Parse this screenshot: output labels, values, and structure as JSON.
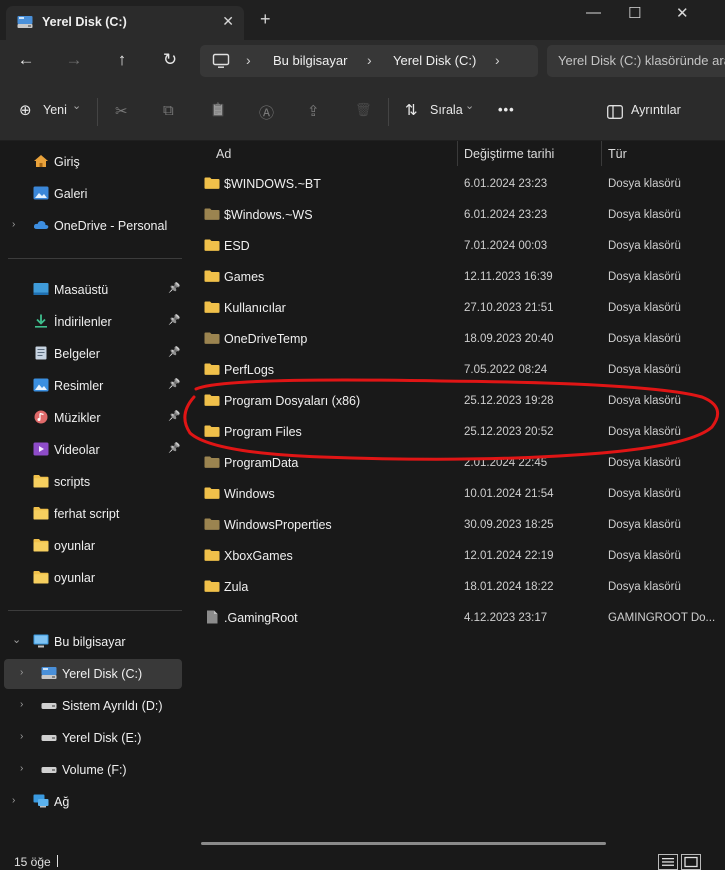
{
  "window": {
    "tab_title": "Yerel Disk (C:)",
    "tab_close": "✕",
    "new_tab": "+",
    "minimize": "—",
    "maximize": "☐",
    "close": "✕"
  },
  "navigation": {
    "back": "←",
    "forward": "→",
    "up": "↑",
    "refresh": "↻",
    "separator": "›",
    "breadcrumbs": [
      "Bu bilgisayar",
      "Yerel Disk (C:)"
    ],
    "search_placeholder": "Yerel Disk (C:) klasöründe ara"
  },
  "commandbar": {
    "new_plus": "⊕",
    "new_label": "Yeni",
    "new_chevron": "⌄",
    "cut": "✂",
    "copy": "⧉",
    "paste": "📋",
    "rename": "Ⓐ",
    "share": "⇪",
    "delete": "🗑",
    "sort_icon": "⇅",
    "sort_label": "Sırala",
    "sort_chevron": "⌄",
    "more": "•••",
    "details_label": "Ayrıntılar"
  },
  "sidebar": {
    "chevron_collapsed": "›",
    "chevron_expanded": "⌄",
    "pin": "📌",
    "top": [
      {
        "label": "Giriş",
        "icon": "home-icon"
      },
      {
        "label": "Galeri",
        "icon": "gallery-icon"
      },
      {
        "label": "OneDrive - Personal",
        "icon": "cloud-icon"
      }
    ],
    "quick_access": [
      {
        "label": "Masaüstü",
        "icon": "desktop-icon",
        "pinned": true
      },
      {
        "label": "İndirilenler",
        "icon": "download-icon",
        "pinned": true
      },
      {
        "label": "Belgeler",
        "icon": "documents-icon",
        "pinned": true
      },
      {
        "label": "Resimler",
        "icon": "pictures-icon",
        "pinned": true
      },
      {
        "label": "Müzikler",
        "icon": "music-icon",
        "pinned": true
      },
      {
        "label": "Videolar",
        "icon": "videos-icon",
        "pinned": true
      },
      {
        "label": "scripts",
        "icon": "folder-icon",
        "pinned": false
      },
      {
        "label": "ferhat script",
        "icon": "folder-icon",
        "pinned": false
      },
      {
        "label": "oyunlar",
        "icon": "folder-icon",
        "pinned": false
      },
      {
        "label": "oyunlar",
        "icon": "folder-icon",
        "pinned": false
      }
    ],
    "this_pc": {
      "label": "Bu bilgisayar",
      "icon": "computer-icon"
    },
    "drives": [
      {
        "label": "Yerel Disk (C:)",
        "icon": "system-drive-icon",
        "selected": true
      },
      {
        "label": "Sistem Ayrıldı (D:)",
        "icon": "drive-icon",
        "selected": false
      },
      {
        "label": "Yerel Disk (E:)",
        "icon": "drive-icon",
        "selected": false
      },
      {
        "label": "Volume (F:)",
        "icon": "drive-icon",
        "selected": false
      }
    ],
    "network": {
      "label": "Ağ",
      "icon": "network-icon"
    }
  },
  "filelist": {
    "columns": {
      "name": "Ad",
      "modified": "Değiştirme tarihi",
      "type": "Tür"
    },
    "sort_indicator": "⌃",
    "rows": [
      {
        "name": "$WINDOWS.~BT",
        "modified": "6.01.2024 23:23",
        "type": "Dosya klasörü",
        "kind": "folder"
      },
      {
        "name": "$Windows.~WS",
        "modified": "6.01.2024 23:23",
        "type": "Dosya klasörü",
        "kind": "folder-dim"
      },
      {
        "name": "ESD",
        "modified": "7.01.2024 00:03",
        "type": "Dosya klasörü",
        "kind": "folder"
      },
      {
        "name": "Games",
        "modified": "12.11.2023 16:39",
        "type": "Dosya klasörü",
        "kind": "folder"
      },
      {
        "name": "Kullanıcılar",
        "modified": "27.10.2023 21:51",
        "type": "Dosya klasörü",
        "kind": "folder"
      },
      {
        "name": "OneDriveTemp",
        "modified": "18.09.2023 20:40",
        "type": "Dosya klasörü",
        "kind": "folder-dim"
      },
      {
        "name": "PerfLogs",
        "modified": "7.05.2022 08:24",
        "type": "Dosya klasörü",
        "kind": "folder"
      },
      {
        "name": "Program Dosyaları (x86)",
        "modified": "25.12.2023 19:28",
        "type": "Dosya klasörü",
        "kind": "folder"
      },
      {
        "name": "Program Files",
        "modified": "25.12.2023 20:52",
        "type": "Dosya klasörü",
        "kind": "folder"
      },
      {
        "name": "ProgramData",
        "modified": "2.01.2024 22:45",
        "type": "Dosya klasörü",
        "kind": "folder-dim"
      },
      {
        "name": "Windows",
        "modified": "10.01.2024 21:54",
        "type": "Dosya klasörü",
        "kind": "folder"
      },
      {
        "name": "WindowsProperties",
        "modified": "30.09.2023 18:25",
        "type": "Dosya klasörü",
        "kind": "folder-dim"
      },
      {
        "name": "XboxGames",
        "modified": "12.01.2024 22:19",
        "type": "Dosya klasörü",
        "kind": "folder"
      },
      {
        "name": "Zula",
        "modified": "18.01.2024 18:22",
        "type": "Dosya klasörü",
        "kind": "folder"
      },
      {
        "name": ".GamingRoot",
        "modified": "4.12.2023 23:17",
        "type": "GAMINGROOT Do...",
        "kind": "file"
      }
    ]
  },
  "status": {
    "item_count": "15 öğe"
  },
  "colors": {
    "folder": "#f0c04a",
    "folder_dim": "#9b8450",
    "annotation": "#e01515",
    "selected_bg": "#393939"
  }
}
